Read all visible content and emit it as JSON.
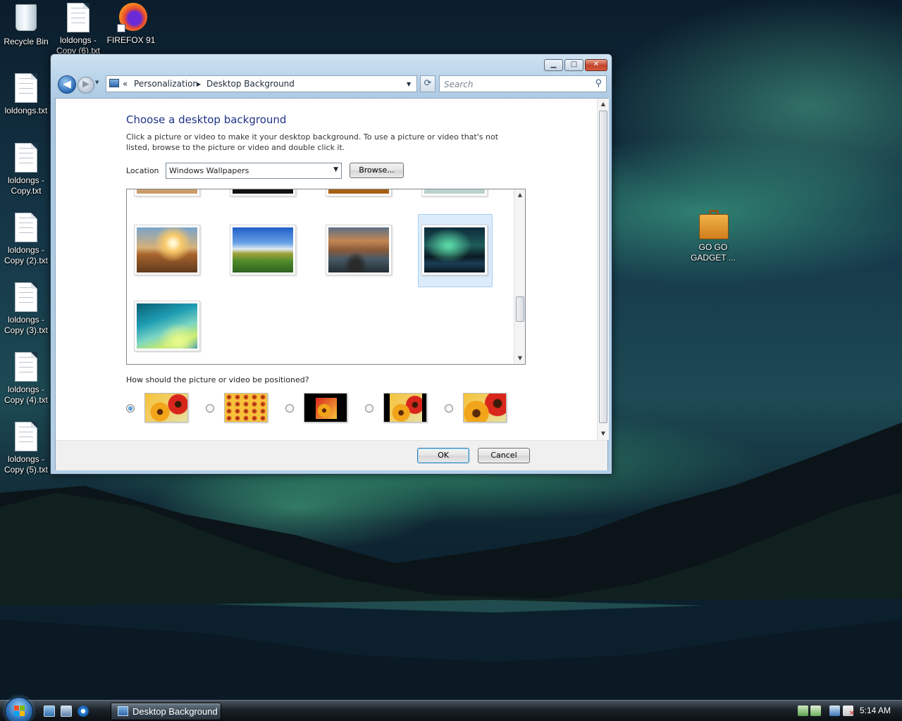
{
  "desktop": {
    "icons": [
      {
        "label": "Recycle Bin"
      },
      {
        "label": "loldongs - Copy (6).txt"
      },
      {
        "label": "FIREFOX 91"
      },
      {
        "label": "loldongs.txt"
      },
      {
        "label": "loldongs - Copy.txt"
      },
      {
        "label": "loldongs - Copy (2).txt"
      },
      {
        "label": "loldongs - Copy (3).txt"
      },
      {
        "label": "loldongs - Copy (4).txt"
      },
      {
        "label": "loldongs - Copy (5).txt"
      },
      {
        "label": "GO GO GADGET ..."
      }
    ]
  },
  "window": {
    "controls": {
      "minimize": "▁",
      "maximize": "□",
      "close": "✕"
    },
    "nav": {
      "back": "◀",
      "forward": "▶",
      "breadcrumb_prefix": "«",
      "crumb1": "Personalization",
      "separator": "▶",
      "crumb2": "Desktop Background",
      "dropdown_arrow": "▼",
      "refresh": "⟳",
      "search_placeholder": "Search",
      "search_icon": "⚲"
    },
    "content": {
      "heading": "Choose a desktop background",
      "description": "Click a picture or video to make it your desktop background. To use a picture or video that's not listed, browse to the picture or video and double click it.",
      "location_label": "Location",
      "location_value": "Windows Wallpapers",
      "browse_button": "Browse...",
      "position_question": "How should the picture or video be positioned?",
      "position_options": [
        {
          "name": "fit-to-screen",
          "selected": true
        },
        {
          "name": "tile",
          "selected": false
        },
        {
          "name": "center",
          "selected": false
        },
        {
          "name": "fit-center",
          "selected": false
        },
        {
          "name": "fill",
          "selected": false
        }
      ],
      "wallpapers": [
        {
          "name": "field-sunset"
        },
        {
          "name": "green-hills"
        },
        {
          "name": "lake-rocks"
        },
        {
          "name": "aurora",
          "selected": true
        },
        {
          "name": "vista-aurora"
        }
      ]
    },
    "buttons": {
      "ok": "OK",
      "cancel": "Cancel"
    }
  },
  "taskbar": {
    "task_label": "Desktop Background",
    "clock": "5:14 AM"
  },
  "colors": {
    "heading": "#1e3287",
    "selection": "#dcecfb",
    "taskbar": "#1b2228"
  }
}
